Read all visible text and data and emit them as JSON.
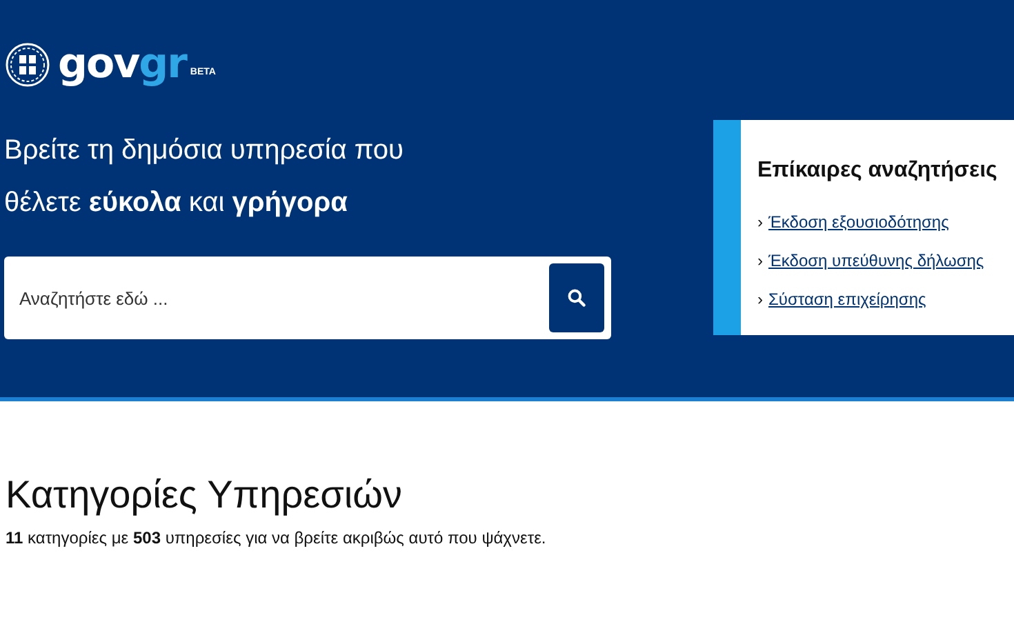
{
  "logo": {
    "primary": "gov",
    "accent": "gr",
    "badge": "BETA"
  },
  "hero": {
    "heading_lines": [
      "Βρείτε τη δημόσια υπηρεσία που",
      "θέλετε **εύκολα** και **γρήγορα**"
    ],
    "search": {
      "placeholder": "Αναζητήστε εδώ ..."
    }
  },
  "trending": {
    "title": "Επίκαιρες αναζητήσεις",
    "links": [
      {
        "marker": "›",
        "label": "Έκδοση εξουσιοδότησης"
      },
      {
        "marker": "›",
        "label": "Έκδοση υπεύθυνης δήλωσης"
      },
      {
        "marker": "›",
        "label": "Σύσταση επιχείρησης"
      }
    ]
  },
  "categories": {
    "title": "Κατηγορίες Υπηρεσιών",
    "summary": "**11** κατηγορίες με **503** υπηρεσίες για να βρείτε ακριβώς αυτό που ψάχνετε."
  }
}
